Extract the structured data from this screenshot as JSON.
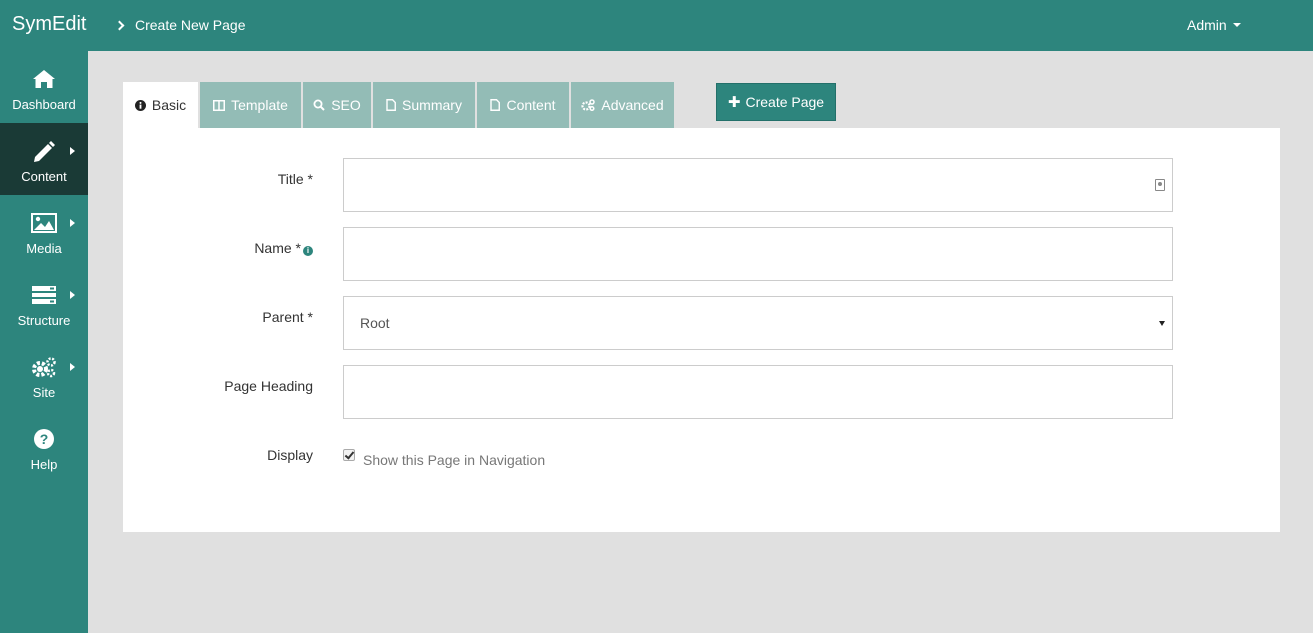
{
  "app": {
    "brand": "SymEdit",
    "breadcrumb": "Create New Page",
    "user": "Admin"
  },
  "sidebar": {
    "items": [
      {
        "label": "Dashboard",
        "icon": "home-icon"
      },
      {
        "label": "Content",
        "icon": "pencil-icon",
        "active": true
      },
      {
        "label": "Media",
        "icon": "image-icon"
      },
      {
        "label": "Structure",
        "icon": "structure-icon"
      },
      {
        "label": "Site",
        "icon": "gears-icon"
      },
      {
        "label": "Help",
        "icon": "question-icon"
      }
    ]
  },
  "tabs": [
    {
      "label": "Basic",
      "icon": "info-icon",
      "active": true
    },
    {
      "label": "Template",
      "icon": "columns-icon"
    },
    {
      "label": "SEO",
      "icon": "search-icon"
    },
    {
      "label": "Summary",
      "icon": "file-icon"
    },
    {
      "label": "Content",
      "icon": "file-icon"
    },
    {
      "label": "Advanced",
      "icon": "gears-icon"
    }
  ],
  "actions": {
    "create_page": "Create Page"
  },
  "form": {
    "title_label": "Title *",
    "title_value": "",
    "name_label": "Name *",
    "name_value": "",
    "parent_label": "Parent *",
    "parent_value": "Root",
    "heading_label": "Page Heading",
    "heading_value": "",
    "display_label": "Display",
    "display_checkbox_label": "Show this Page in Navigation",
    "display_checked": true
  },
  "colors": {
    "accent": "#2d857d",
    "active_nav": "#1a3a36",
    "inactive_tab": "#93bcb6",
    "background": "#e0e0e0"
  }
}
